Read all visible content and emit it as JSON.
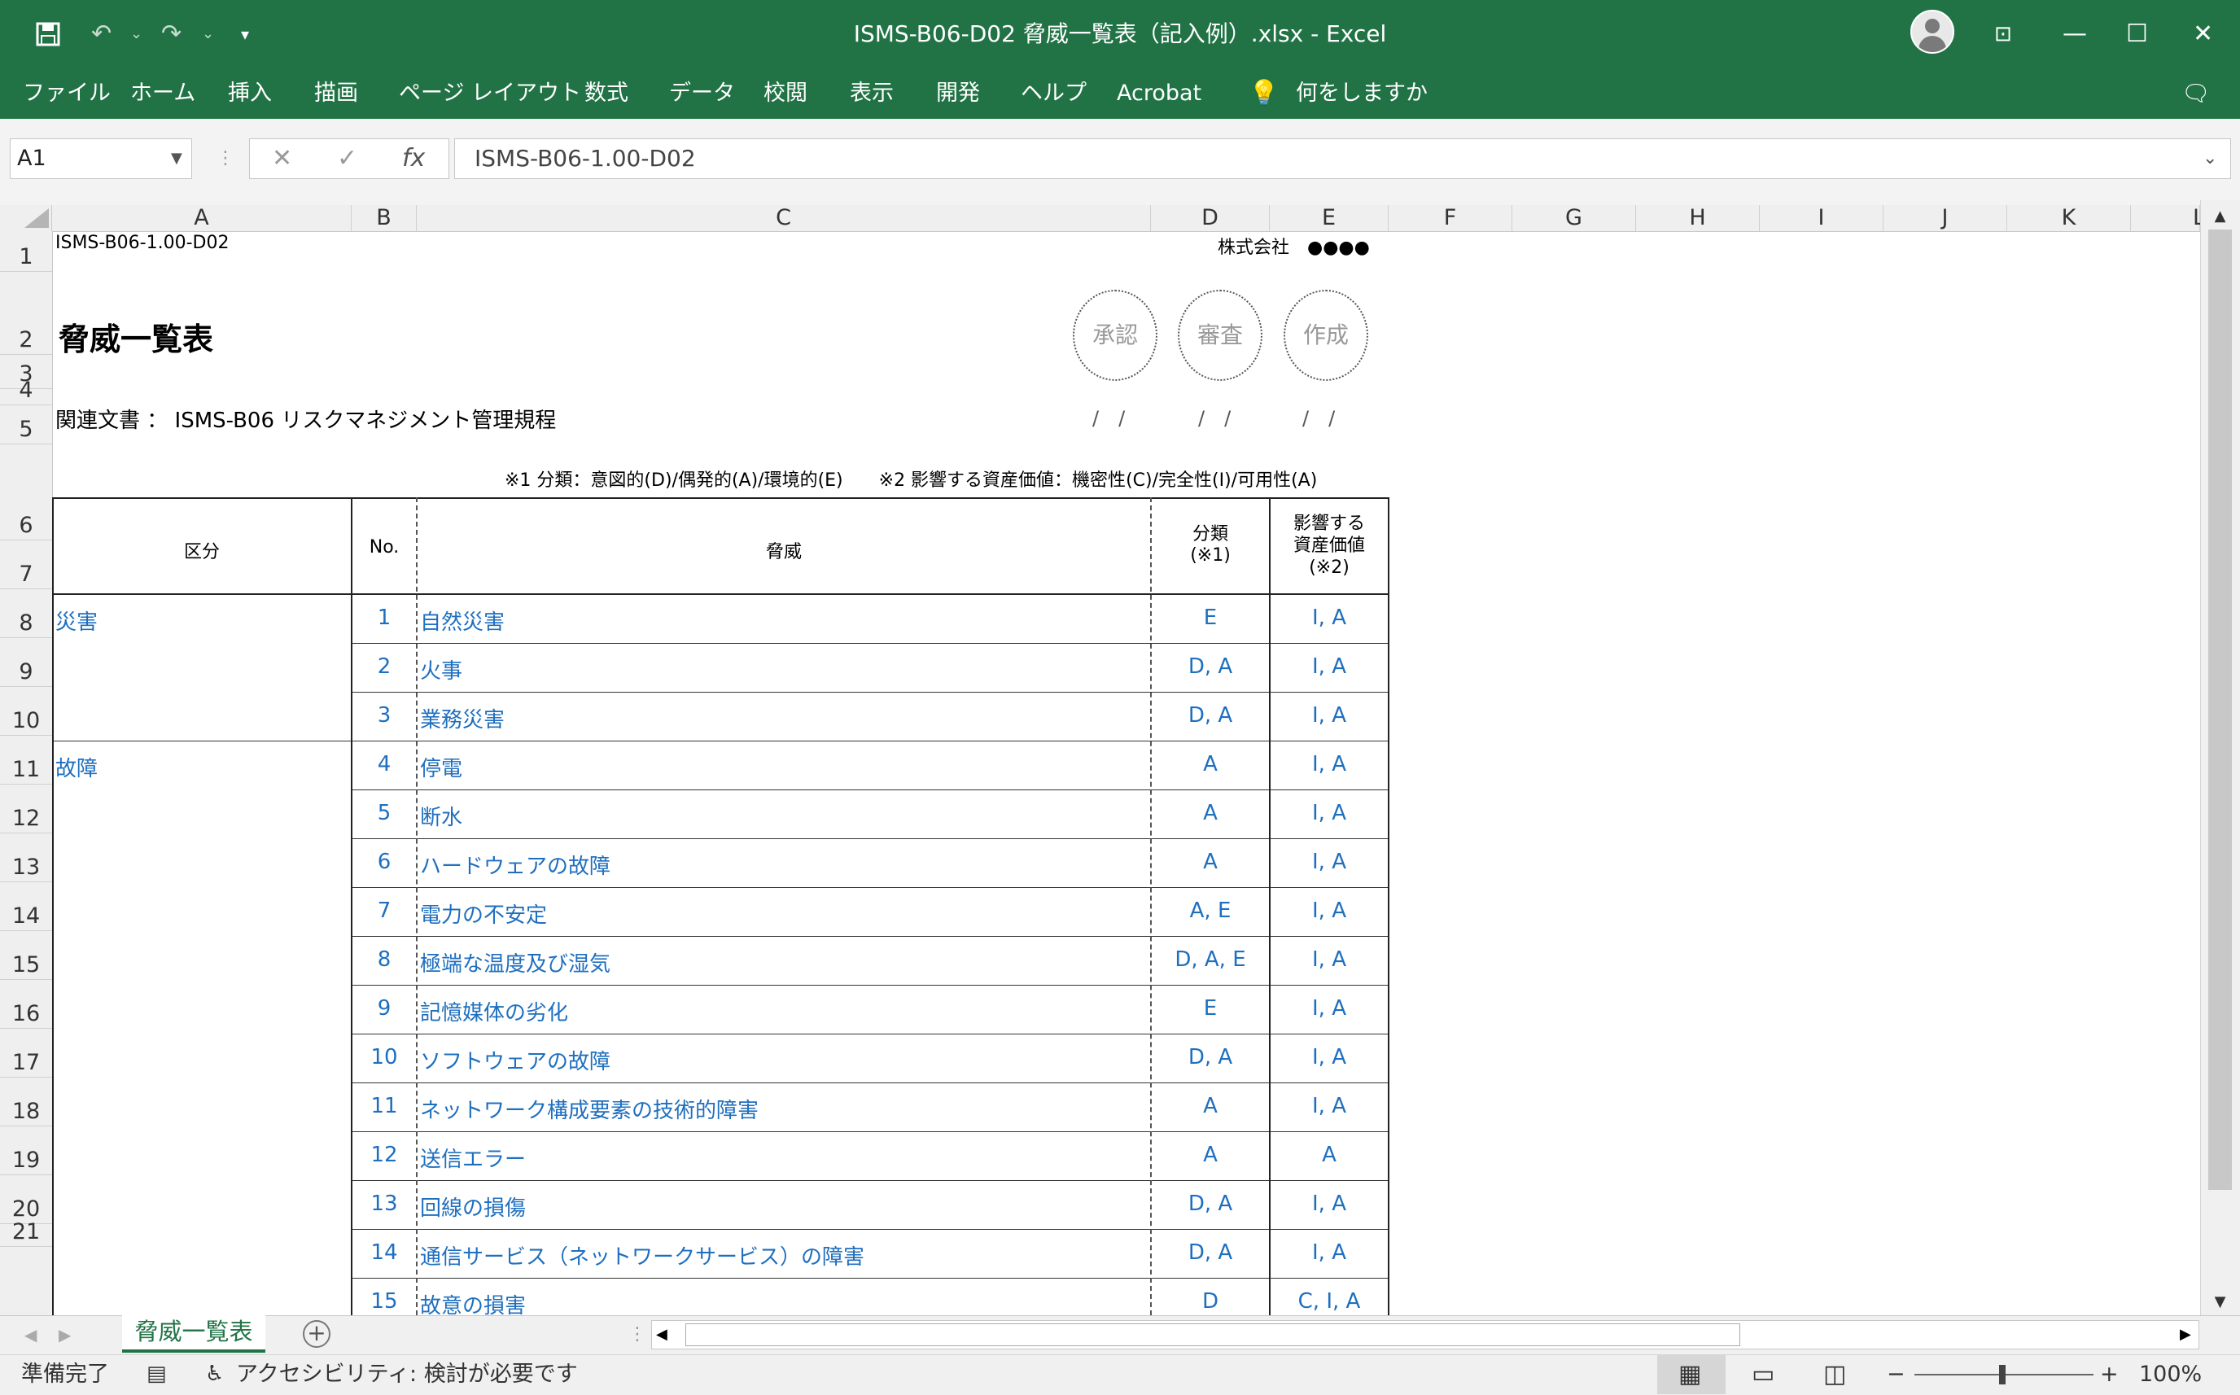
{
  "window": {
    "title": "ISMS-B06-D02 脅威一覧表（記入例）.xlsx  -  Excel",
    "icons": [
      "save-icon",
      "undo-icon",
      "redo-icon",
      "customize-qat-icon",
      "account-icon",
      "ribbon-display-icon",
      "minimize-icon",
      "maximize-icon",
      "close-icon"
    ]
  },
  "ribbon": {
    "tabs": [
      "ファイル",
      "ホーム",
      "挿入",
      "描画",
      "ページ レイアウト",
      "数式",
      "データ",
      "校閲",
      "表示",
      "開発",
      "ヘルプ",
      "Acrobat"
    ],
    "tell_me": "何をしますか"
  },
  "formula_bar": {
    "name_box": "A1",
    "formula": "ISMS-B06-1.00-D02",
    "fx": "fx"
  },
  "columns": [
    "A",
    "B",
    "C",
    "D",
    "E",
    "F",
    "G",
    "H",
    "I",
    "J",
    "K",
    "L"
  ],
  "rows": [
    "1",
    "2",
    "3",
    "4",
    "5",
    "6",
    "7",
    "8",
    "9",
    "10",
    "11",
    "12",
    "13",
    "14",
    "15",
    "16",
    "17",
    "18",
    "19",
    "20",
    "21"
  ],
  "sheet": {
    "doc_id": "ISMS-B06-1.00-D02",
    "company": "株式会社　●●●●",
    "title": "脅威一覧表",
    "related_doc": "関連文書 ： ISMS-B06 リスクマネジメント管理規程",
    "stamps": [
      "承認",
      "審査",
      "作成"
    ],
    "date_mark": "/　/",
    "note": "※1 分類：意図的(D)/偶発的(A)/環境的(E)　　※2 影響する資産価値：機密性(C)/完全性(I)/可用性(A)",
    "headers": {
      "category": "区分",
      "no": "No.",
      "threat": "脅威",
      "class": "分類\n(※1)",
      "impact": "影響する\n資産価値\n(※2)"
    },
    "groups": [
      {
        "label": "災害",
        "row": 0
      },
      {
        "label": "故障",
        "row": 3
      }
    ],
    "table_rows": [
      {
        "no": "1",
        "threat": "自然災害",
        "class": "E",
        "impact": "I, A"
      },
      {
        "no": "2",
        "threat": "火事",
        "class": "D, A",
        "impact": "I, A"
      },
      {
        "no": "3",
        "threat": "業務災害",
        "class": "D, A",
        "impact": "I, A"
      },
      {
        "no": "4",
        "threat": "停電",
        "class": "A",
        "impact": "I, A"
      },
      {
        "no": "5",
        "threat": "断水",
        "class": "A",
        "impact": "I, A"
      },
      {
        "no": "6",
        "threat": "ハードウェアの故障",
        "class": "A",
        "impact": "I, A"
      },
      {
        "no": "7",
        "threat": "電力の不安定",
        "class": "A, E",
        "impact": "I, A"
      },
      {
        "no": "8",
        "threat": "極端な温度及び湿気",
        "class": "D, A, E",
        "impact": "I, A"
      },
      {
        "no": "9",
        "threat": "記憶媒体の劣化",
        "class": "E",
        "impact": "I, A"
      },
      {
        "no": "10",
        "threat": "ソフトウェアの故障",
        "class": "D, A",
        "impact": "I, A"
      },
      {
        "no": "11",
        "threat": "ネットワーク構成要素の技術的障害",
        "class": "A",
        "impact": "I, A"
      },
      {
        "no": "12",
        "threat": "送信エラー",
        "class": "A",
        "impact": "A"
      },
      {
        "no": "13",
        "threat": "回線の損傷",
        "class": "D, A",
        "impact": "I, A"
      },
      {
        "no": "14",
        "threat": "通信サービス（ネットワークサービス）の障害",
        "class": "D, A",
        "impact": "I, A"
      },
      {
        "no": "15",
        "threat": "故意の損害",
        "class": "D",
        "impact": "C, I, A"
      }
    ]
  },
  "sheet_tab": "脅威一覧表",
  "status": {
    "ready": "準備完了",
    "accessibility": "アクセシビリティ: 検討が必要です",
    "zoom": "100%"
  }
}
